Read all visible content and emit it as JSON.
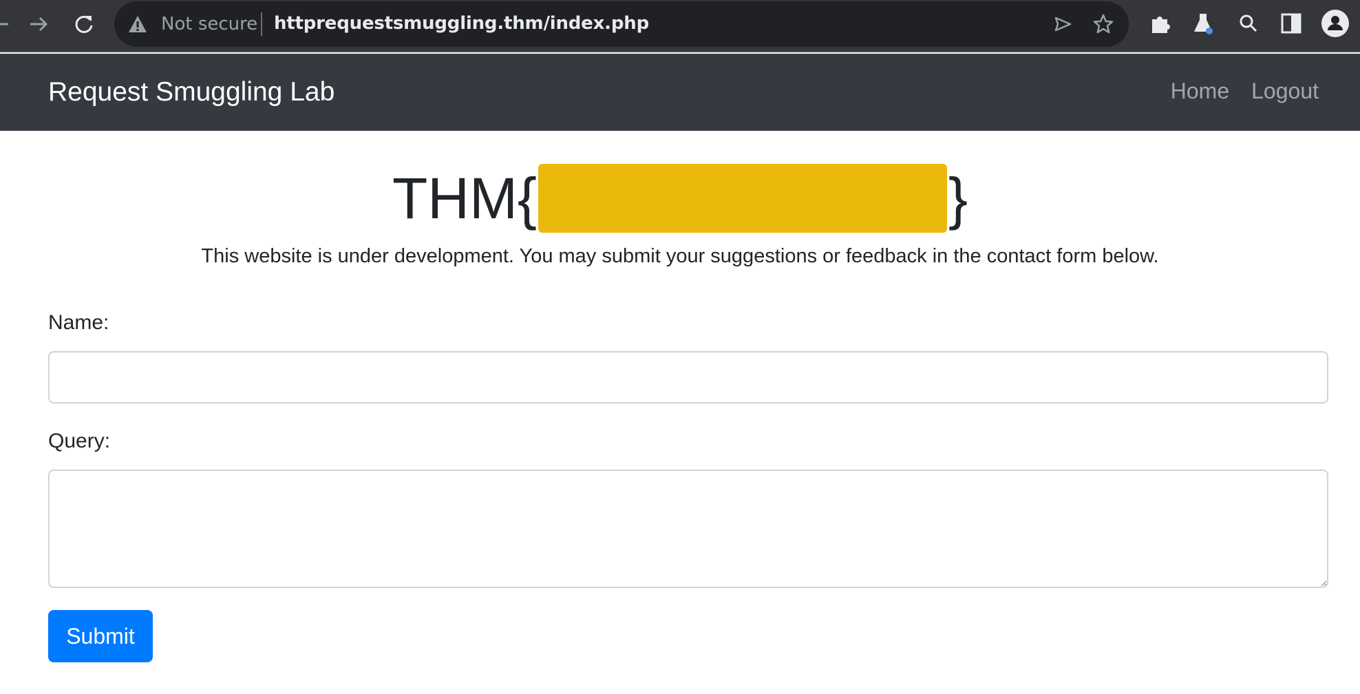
{
  "browser": {
    "security_label": "Not secure",
    "url": "httprequestsmuggling.thm/index.php",
    "icons": [
      "back-arrow-icon",
      "forward-arrow-icon",
      "reload-icon",
      "warning-icon",
      "send-icon",
      "star-icon",
      "extensions-icon",
      "labs-flask-icon",
      "search-icon",
      "side-panel-icon",
      "profile-icon"
    ]
  },
  "navbar": {
    "brand": "Request Smuggling Lab",
    "links": [
      "Home",
      "Logout"
    ],
    "background": "#343a40"
  },
  "main": {
    "flag_prefix": "THM{",
    "flag_suffix": "}",
    "redaction_color": "#ebb90c",
    "lead_text": "This website is under development. You may submit your suggestions or feedback in the contact form below."
  },
  "form": {
    "name_label": "Name:",
    "name_value": "",
    "query_label": "Query:",
    "query_value": "",
    "submit_label": "Submit",
    "submit_color": "#007bff"
  }
}
